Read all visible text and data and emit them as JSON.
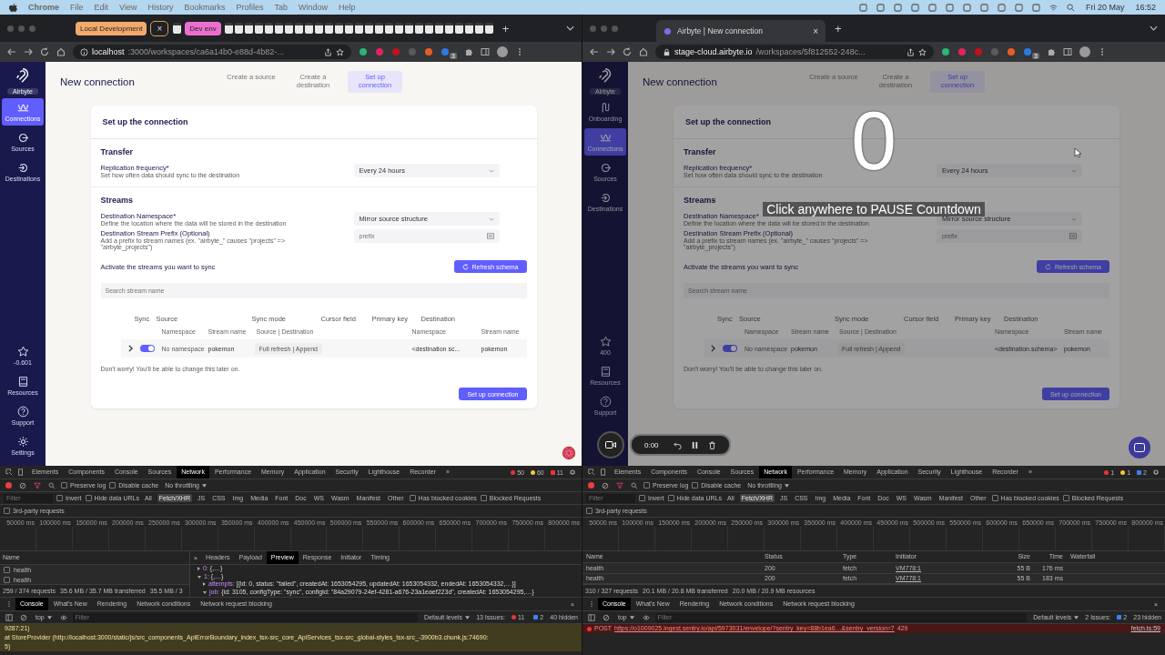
{
  "menubar": {
    "app": "Chrome",
    "menus": [
      "File",
      "Edit",
      "View",
      "History",
      "Bookmarks",
      "Profiles",
      "Tab",
      "Window",
      "Help"
    ],
    "date": "Fri 20 May",
    "time": "16:52"
  },
  "windows": [
    {
      "tab_groups": [
        {
          "label": "Local Development",
          "color": "#f2aa6c"
        },
        {
          "label": "Dev env",
          "color": "#ec6fd0"
        }
      ],
      "close": "×",
      "new_tab": "+",
      "url_host": "localhost",
      "url_path": ":3000/workspaces/ca6a14b0-e88d-4b82-...",
      "secure": false,
      "extension_badge": "3",
      "app": {
        "logo_label": "Airbyte",
        "title": "New connection",
        "steps": [
          {
            "label": "Create a source",
            "selected": false
          },
          {
            "label": "Create a destination",
            "selected": false
          },
          {
            "label": "Set up connection",
            "selected": true
          }
        ],
        "nav": [
          {
            "kind": "connections",
            "label": "Connections",
            "selected": true
          },
          {
            "kind": "sources",
            "label": "Sources",
            "selected": false
          },
          {
            "kind": "destinations",
            "label": "Destinations",
            "selected": false
          }
        ],
        "nav_bottom": [
          {
            "kind": "star",
            "label": "-0.601"
          },
          {
            "kind": "book",
            "label": "Resources"
          },
          {
            "kind": "help",
            "label": "Support"
          },
          {
            "kind": "gear",
            "label": "Settings"
          }
        ],
        "card_title": "Set up the connection",
        "transfer_title": "Transfer",
        "frequency_label": "Replication frequency*",
        "frequency_hint": "Set how often data should sync to the destination",
        "frequency_value": "Every 24 hours",
        "streams_title": "Streams",
        "namespace_label": "Destination Namespace*",
        "namespace_hint": "Define the location where the data will be stored in the destination",
        "namespace_value": "Mirror source structure",
        "prefix_label": "Destination Stream Prefix (Optional)",
        "prefix_hint": "Add a prefix to stream names (ex. \"airbyte_\" causes \"projects\" => \"airbyte_projects\")",
        "prefix_placeholder": "prefix",
        "activate_label": "Activate the streams you want to sync",
        "refresh_button": "Refresh schema",
        "search_placeholder": "Search stream name",
        "columns": [
          "Sync",
          "Source",
          "Sync mode",
          "Cursor field",
          "Primary key",
          "Destination"
        ],
        "subcolumns": [
          "Namespace",
          "Stream name",
          "Source | Destination",
          "Namespace",
          "Stream name"
        ],
        "row": {
          "on": true,
          "namespace": "No namespace",
          "stream": "pokemon",
          "mode": "Full refresh | Append",
          "dest_namespace": "<destination sc...",
          "dest_stream": "pokemon"
        },
        "note": "Don't worry! You'll be able to change this later on.",
        "submit": "Set up connection"
      },
      "devtools": {
        "tabs": [
          {
            "label": "Elements",
            "selected": false
          },
          {
            "label": "Components",
            "selected": false
          },
          {
            "label": "Console",
            "selected": false
          },
          {
            "label": "Sources",
            "selected": false
          },
          {
            "label": "Network",
            "selected": true
          },
          {
            "label": "Performance",
            "selected": false
          },
          {
            "label": "Memory",
            "selected": false
          },
          {
            "label": "Application",
            "selected": false
          },
          {
            "label": "Security",
            "selected": false
          },
          {
            "label": "Lighthouse",
            "selected": false
          },
          {
            "label": "Recorder",
            "selected": false
          },
          {
            "label": "»",
            "selected": false
          }
        ],
        "counts": [
          {
            "kind": "error",
            "text": "50"
          },
          {
            "kind": "warning",
            "text": "60"
          },
          {
            "kind": "issue",
            "text": "11"
          }
        ],
        "checks": [
          {
            "label": "Preserve log",
            "checked": false
          },
          {
            "label": "Disable cache",
            "checked": false
          }
        ],
        "throttling": "No throttling",
        "filter": {
          "placeholder": "Filter"
        },
        "filter_checks": [
          {
            "label": "Invert",
            "checked": false
          },
          {
            "label": "Hide data URLs",
            "checked": false
          }
        ],
        "types": [
          {
            "label": "All",
            "selected": false
          },
          {
            "label": "Fetch/XHR",
            "selected": true
          },
          {
            "label": "JS",
            "selected": false
          },
          {
            "label": "CSS",
            "selected": false
          },
          {
            "label": "Img",
            "selected": false
          },
          {
            "label": "Media",
            "selected": false
          },
          {
            "label": "Font",
            "selected": false
          },
          {
            "label": "Doc",
            "selected": false
          },
          {
            "label": "WS",
            "selected": false
          },
          {
            "label": "Wasm",
            "selected": false
          },
          {
            "label": "Manifest",
            "selected": false
          },
          {
            "label": "Other",
            "selected": false
          }
        ],
        "extra_checks": [
          {
            "label": "Has blocked cookies",
            "checked": false
          },
          {
            "label": "Blocked Requests",
            "checked": false
          }
        ],
        "third_party": {
          "label": "3rd-party requests",
          "checked": false
        },
        "ticks": [
          "50000 ms",
          "100000 ms",
          "150000 ms",
          "200000 ms",
          "250000 ms",
          "300000 ms",
          "350000 ms",
          "400000 ms",
          "450000 ms",
          "500000 ms",
          "550000 ms",
          "600000 ms",
          "650000 ms",
          "700000 ms",
          "750000 ms",
          "800000 ms"
        ],
        "requests": {
          "kind": "split",
          "name_header": "Name",
          "names": [
            "health",
            "health"
          ],
          "summary": [
            "259 / 374 requests",
            "35.6 MB / 35.7 MB transferred",
            "35.5 MB / 3"
          ],
          "detail_close": "×",
          "detail_tabs": [
            {
              "label": "Headers",
              "selected": false
            },
            {
              "label": "Payload",
              "selected": false
            },
            {
              "label": "Preview",
              "selected": true
            },
            {
              "label": "Response",
              "selected": false
            },
            {
              "label": "Initiator",
              "selected": false
            },
            {
              "label": "Timing",
              "selected": false
            }
          ],
          "preview": [
            {
              "expanded": false,
              "indent": false,
              "key": "0:",
              "value": "{,…}"
            },
            {
              "expanded": true,
              "indent": false,
              "key": "1:",
              "value": "{,…}"
            },
            {
              "expanded": false,
              "indent": true,
              "key": "attempts:",
              "value": "[{id: 0, status: \"failed\", createdAt: 1653054295, updatedAt: 1653054332, endedAt: 1653054332,…}]"
            },
            {
              "expanded": true,
              "indent": true,
              "key": "job:",
              "value": "{id: 3105, configType: \"sync\", configId: \"84a29079-24ef-4281-a676-23a1eaef223d\", createdAt: 1653054295,…}"
            }
          ]
        },
        "drawer_tabs": [
          {
            "label": "Console",
            "selected": true
          },
          {
            "label": "What's New",
            "selected": false
          },
          {
            "label": "Rendering",
            "selected": false
          },
          {
            "label": "Network conditions",
            "selected": false
          },
          {
            "label": "Network request blocking",
            "selected": false
          }
        ],
        "context": "top",
        "console_filter": {
          "placeholder": "Filter"
        },
        "levels": "Default levels",
        "issues_label": "13 Issues:",
        "issue_counts": [
          {
            "kind": "error",
            "text": "11"
          },
          {
            "kind": "info",
            "text": "2"
          }
        ],
        "hidden": "40 hidden",
        "messages": [
          {
            "kind": "warning",
            "text": "9287:21)"
          },
          {
            "kind": "warning",
            "text": "at StoreProvider (http://localhost:3000/static/js/src_components_ApiErrorBoundary_index_tsx-src_core_ApiServices_tsx-src_global-styles_tsx-src_-3900b3.chunk.js:74690:"
          },
          {
            "kind": "warning",
            "text": "5)"
          }
        ]
      }
    },
    {
      "tabs": [
        {
          "label": "Airbyte | New connection",
          "selected": true
        }
      ],
      "close": "×",
      "new_tab": "+",
      "url_host": "stage-cloud.airbyte.io",
      "url_path": "/workspaces/5f812552-248c...",
      "secure": true,
      "extension_badge": "3",
      "app": {
        "logo_label": "Airbyte",
        "title": "New connection",
        "steps": [
          {
            "label": "Create a source",
            "selected": false
          },
          {
            "label": "Create a destination",
            "selected": false
          },
          {
            "label": "Set up connection",
            "selected": true
          }
        ],
        "nav": [
          {
            "kind": "onboarding",
            "label": "Onboarding",
            "selected": false
          },
          {
            "kind": "connections",
            "label": "Connections",
            "selected": true
          },
          {
            "kind": "sources",
            "label": "Sources",
            "selected": false
          },
          {
            "kind": "destinations",
            "label": "Destinations",
            "selected": false
          }
        ],
        "nav_bottom": [
          {
            "kind": "star",
            "label": "400"
          },
          {
            "kind": "book",
            "label": "Resources"
          },
          {
            "kind": "help",
            "label": "Support"
          }
        ],
        "card_title": "Set up the connection",
        "transfer_title": "Transfer",
        "frequency_label": "Replication frequency*",
        "frequency_hint": "Set how often data should sync to the destination",
        "frequency_value": "Every 24 hours",
        "streams_title": "Streams",
        "namespace_label": "Destination Namespace*",
        "namespace_hint": "Define the location where the data will be stored in the destination",
        "namespace_value": "Mirror source structure",
        "prefix_label": "Destination Stream Prefix (Optional)",
        "prefix_hint": "Add a prefix to stream names (ex. \"airbyte_\" causes \"projects\" => \"airbyte_projects\")",
        "prefix_placeholder": "prefix",
        "activate_label": "Activate the streams you want to sync",
        "refresh_button": "Refresh schema",
        "search_placeholder": "Search stream name",
        "columns": [
          "Sync",
          "Source",
          "Sync mode",
          "Cursor field",
          "Primary key",
          "Destination"
        ],
        "subcolumns": [
          "Namespace",
          "Stream name",
          "Source | Destination",
          "Namespace",
          "Stream name"
        ],
        "row": {
          "on": true,
          "namespace": "No namespace",
          "stream": "pokemon",
          "mode": "Full refresh | Append",
          "dest_namespace": "<destination.schema>",
          "dest_stream": "pokemon"
        },
        "note": "Don't worry! You'll be able to change this later on.",
        "submit": "Set up connection"
      },
      "recording": {
        "countdown": "0",
        "hint": "Click anywhere to PAUSE Countdown",
        "timer": "0:00"
      },
      "devtools": {
        "tabs": [
          {
            "label": "Elements",
            "selected": false
          },
          {
            "label": "Components",
            "selected": false
          },
          {
            "label": "Console",
            "selected": false
          },
          {
            "label": "Sources",
            "selected": false
          },
          {
            "label": "Network",
            "selected": true
          },
          {
            "label": "Performance",
            "selected": false
          },
          {
            "label": "Memory",
            "selected": false
          },
          {
            "label": "Application",
            "selected": false
          },
          {
            "label": "Security",
            "selected": false
          },
          {
            "label": "Lighthouse",
            "selected": false
          },
          {
            "label": "Recorder",
            "selected": false
          },
          {
            "label": "»",
            "selected": false
          }
        ],
        "counts": [
          {
            "kind": "error",
            "text": "1"
          },
          {
            "kind": "warning",
            "text": "1"
          },
          {
            "kind": "info",
            "text": "2"
          }
        ],
        "checks": [
          {
            "label": "Preserve log",
            "checked": false
          },
          {
            "label": "Disable cache",
            "checked": false
          }
        ],
        "throttling": "No throttling",
        "filter": {
          "placeholder": "Filter"
        },
        "filter_checks": [
          {
            "label": "Invert",
            "checked": false
          },
          {
            "label": "Hide data URLs",
            "checked": false
          }
        ],
        "types": [
          {
            "label": "All",
            "selected": false
          },
          {
            "label": "Fetch/XHR",
            "selected": true
          },
          {
            "label": "JS",
            "selected": false
          },
          {
            "label": "CSS",
            "selected": false
          },
          {
            "label": "Img",
            "selected": false
          },
          {
            "label": "Media",
            "selected": false
          },
          {
            "label": "Font",
            "selected": false
          },
          {
            "label": "Doc",
            "selected": false
          },
          {
            "label": "WS",
            "selected": false
          },
          {
            "label": "Wasm",
            "selected": false
          },
          {
            "label": "Manifest",
            "selected": false
          },
          {
            "label": "Other",
            "selected": false
          }
        ],
        "extra_checks": [
          {
            "label": "Has blocked cookies",
            "checked": false
          },
          {
            "label": "Blocked Requests",
            "checked": false
          }
        ],
        "third_party": {
          "label": "3rd-party requests",
          "checked": false
        },
        "ticks": [
          "50000 ms",
          "100000 ms",
          "150000 ms",
          "200000 ms",
          "250000 ms",
          "300000 ms",
          "350000 ms",
          "400000 ms",
          "450000 ms",
          "500000 ms",
          "550000 ms",
          "600000 ms",
          "650000 ms",
          "700000 ms",
          "750000 ms",
          "800000 ms"
        ],
        "requests": {
          "kind": "table",
          "columns": [
            "Name",
            "Status",
            "Type",
            "Initiator",
            "Size",
            "Time",
            "Waterfall"
          ],
          "rows": [
            [
              "health",
              "200",
              "fetch",
              "VM778:1",
              "55 B",
              "176 ms"
            ],
            [
              "health",
              "200",
              "fetch",
              "VM778:1",
              "55 B",
              "183 ms"
            ]
          ],
          "summary": [
            "310 / 327 requests",
            "20.1 MB / 20.8 MB transferred",
            "20.0 MB / 20.9 MB resources"
          ]
        },
        "drawer_tabs": [
          {
            "label": "Console",
            "selected": true
          },
          {
            "label": "What's New",
            "selected": false
          },
          {
            "label": "Rendering",
            "selected": false
          },
          {
            "label": "Network conditions",
            "selected": false
          },
          {
            "label": "Network request blocking",
            "selected": false
          }
        ],
        "context": "top",
        "console_filter": {
          "placeholder": "Filter"
        },
        "levels": "Default levels",
        "issues_label": "2 Issues:",
        "issue_counts": [
          {
            "kind": "info",
            "text": "2"
          }
        ],
        "hidden": "23 hidden",
        "messages": [
          {
            "kind": "error",
            "method": "POST",
            "url": "https://o1009025.ingest.sentry.io/api/5973031/envelope/?sentry_key=88b1ea6…&sentry_version=7",
            "status": "429",
            "source": "fetch.ts:59"
          }
        ]
      }
    }
  ]
}
